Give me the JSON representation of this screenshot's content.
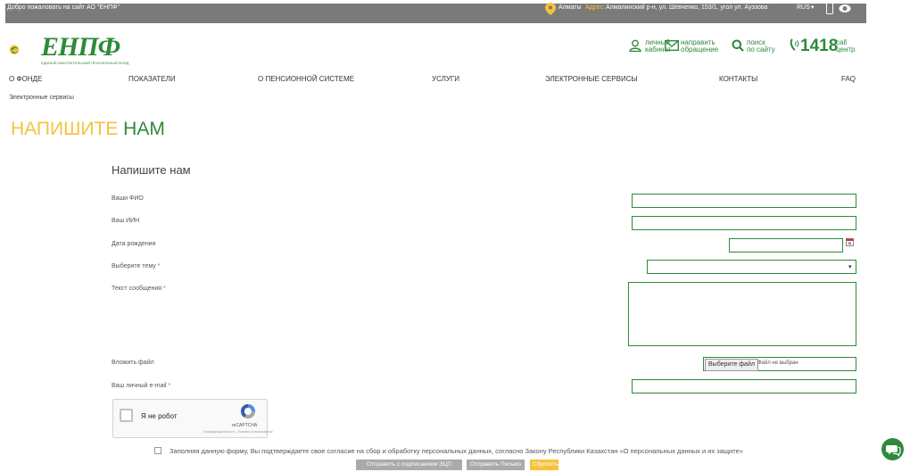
{
  "topbar": {
    "welcome": "Добро пожаловать на сайт АО \"ЕНПФ\"",
    "city": "Алматы",
    "address_label": "Адрес:",
    "address": "Алмалинский р-н, ул. Шевченко, 153/1, угол ул. Ауэзова",
    "language": "RUS"
  },
  "brand": {
    "logo_text": "ЕНПФ",
    "logo_tagline": "ЕДИНЫЙ НАКОПИТЕЛЬНЫЙ ПЕНСИОННЫЙ ФОНД"
  },
  "header_links": {
    "cabinet_1": "личный",
    "cabinet_2": "кабинет",
    "appeal_1": "направить",
    "appeal_2": "обращение",
    "search_1": "поиск",
    "search_2": "по сайту",
    "call_number": "1418",
    "call_1": "call",
    "call_2": "центр"
  },
  "nav": [
    "О ФОНДЕ",
    "ПОКАЗАТЕЛИ",
    "О ПЕНСИОННОЙ СИСТЕМЕ",
    "УСЛУГИ",
    "ЭЛЕКТРОННЫЕ СЕРВИСЫ",
    "КОНТАКТЫ",
    "FAQ"
  ],
  "breadcrumb": "Электронные сервисы",
  "page_title": {
    "highlight": "НАПИШИТЕ",
    "rest": "НАМ"
  },
  "form": {
    "heading": "Напишите нам",
    "fio_label": "Ваши ФИО",
    "iin_label": "Ваш ИИН",
    "dob_label": "Дата рождения",
    "topic_label": "Выберите тему",
    "message_label": "Текст сообщения",
    "file_label": "Вложить файл",
    "file_button": "Выберите файл",
    "file_status": "Файл не выбран",
    "email_label": "Ваш личный e-mail",
    "required_mark": "*"
  },
  "captcha": {
    "label": "Я не робот",
    "brand": "reCAPTCHA",
    "terms": "Конфиденциальность - Условия использования"
  },
  "consent": "Заполняя данную форму, Вы подтверждаете свое согласие на сбор и обработку персональных данных, согласно Закону Республики Казахстан «О персональных данных и их защите»",
  "buttons": {
    "eds": "Отправить с подписанием ЭЦП",
    "letter": "Отправить Письмо",
    "reset": "Сбросить"
  },
  "colors": {
    "brand_green": "#2e8a3b",
    "accent_yellow": "#f5c33b",
    "topbar_grey": "#7a7a7a"
  }
}
